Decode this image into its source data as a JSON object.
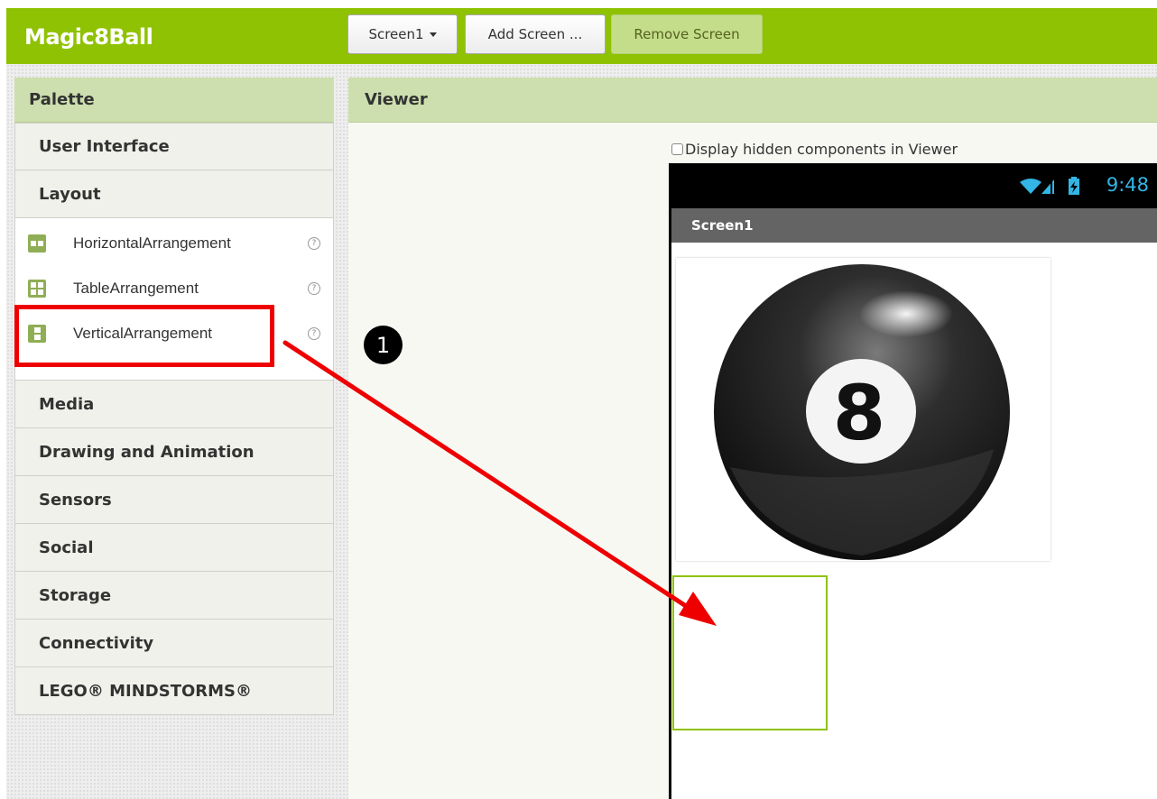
{
  "header": {
    "app_title": "Magic8Ball",
    "screen_select": "Screen1",
    "add_screen": "Add Screen ...",
    "remove_screen": "Remove Screen"
  },
  "palette": {
    "title": "Palette",
    "categories": {
      "user_interface": "User Interface",
      "layout": "Layout",
      "media": "Media",
      "drawing": "Drawing and Animation",
      "sensors": "Sensors",
      "social": "Social",
      "storage": "Storage",
      "connectivity": "Connectivity",
      "lego": "LEGO® MINDSTORMS®"
    },
    "layout_items": [
      {
        "label": "HorizontalArrangement",
        "icon": "horizontal-arrangement-icon"
      },
      {
        "label": "TableArrangement",
        "icon": "table-arrangement-icon"
      },
      {
        "label": "VerticalArrangement",
        "icon": "vertical-arrangement-icon"
      }
    ],
    "help_glyph": "?"
  },
  "viewer": {
    "title": "Viewer",
    "hidden_checkbox_label": "Display hidden components in Viewer",
    "phone": {
      "time": "9:48",
      "screen_title": "Screen1",
      "ball_number": "8"
    }
  },
  "annotation": {
    "step": "1"
  },
  "colors": {
    "accent_green": "#8fc202",
    "panel_header": "#cddfae",
    "highlight_red": "#ee0000",
    "status_blue": "#33b5e5"
  }
}
